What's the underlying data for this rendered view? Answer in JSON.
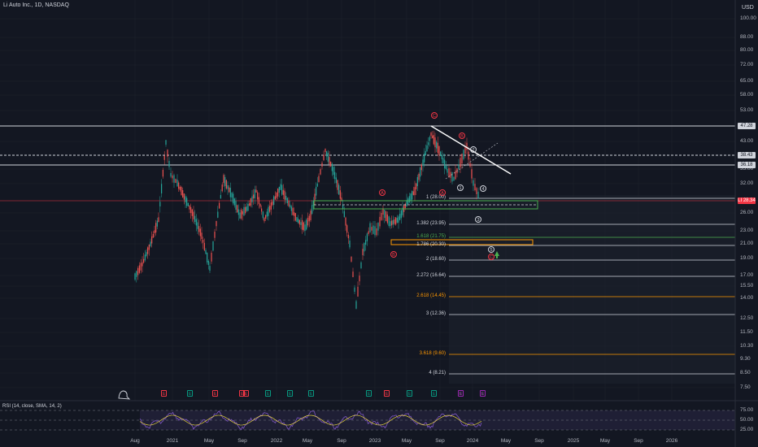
{
  "header": {
    "symbol": "Li Auto Inc., 1D, NASDAQ",
    "currency": "USD"
  },
  "colors": {
    "background": "#131722",
    "up": "#26a69a",
    "down": "#ef5350",
    "rsi": "#7e57c2",
    "accent": "#ff9800"
  },
  "price_axis": {
    "ticks": [
      "100.00",
      "88.00",
      "80.00",
      "72.00",
      "65.00",
      "58.00",
      "53.00",
      "43.00",
      "35.00",
      "32.00",
      "26.00",
      "23.00",
      "21.00",
      "19.00",
      "17.00",
      "15.50",
      "14.00",
      "12.50",
      "11.50",
      "10.30",
      "9.30",
      "8.50",
      "7.50"
    ],
    "levels": [
      {
        "value": "47.28",
        "color": "#d1d4dc"
      },
      {
        "value": "38.43",
        "color": "#d1d4dc"
      },
      {
        "value": "36.18",
        "color": "#d1d4dc"
      },
      {
        "value": "28.34",
        "color": "#f23645",
        "prefix": "LI"
      }
    ]
  },
  "time_axis": {
    "ticks": [
      "Aug",
      "2021",
      "May",
      "Sep",
      "2022",
      "May",
      "Sep",
      "2023",
      "May",
      "Sep",
      "2024",
      "May",
      "Sep",
      "2025",
      "May",
      "Sep",
      "2026"
    ]
  },
  "fib_levels": [
    {
      "label": "1 (28.00)",
      "value": 28.0,
      "color": "#d1d4dc"
    },
    {
      "label": "1.382 (23.95)",
      "value": 23.95,
      "color": "#d1d4dc"
    },
    {
      "label": "1.618 (21.75)",
      "value": 21.75,
      "color": "#4caf50"
    },
    {
      "label": "1.786 (20.30)",
      "value": 20.3,
      "color": "#d1d4dc"
    },
    {
      "label": "2 (18.60)",
      "value": 18.6,
      "color": "#d1d4dc"
    },
    {
      "label": "2.272 (16.64)",
      "value": 16.64,
      "color": "#d1d4dc"
    },
    {
      "label": "2.618 (14.45)",
      "value": 14.45,
      "color": "#ff9800"
    },
    {
      "label": "3 (12.36)",
      "value": 12.36,
      "color": "#d1d4dc"
    },
    {
      "label": "3.618 (9.60)",
      "value": 9.6,
      "color": "#ff9800"
    },
    {
      "label": "4 (8.21)",
      "value": 8.21,
      "color": "#d1d4dc"
    }
  ],
  "waves": [
    {
      "label": "C",
      "color": "red"
    },
    {
      "label": "B",
      "color": "red"
    },
    {
      "label": "A",
      "color": "red"
    },
    {
      "label": "A",
      "color": "red"
    },
    {
      "label": "B",
      "color": "red"
    },
    {
      "label": "C",
      "color": "red"
    },
    {
      "label": "1",
      "color": "white"
    },
    {
      "label": "2",
      "color": "white"
    },
    {
      "label": "3",
      "color": "white"
    },
    {
      "label": "4",
      "color": "white"
    },
    {
      "label": "5",
      "color": "white"
    }
  ],
  "events": [
    {
      "label": "E",
      "type": "e"
    },
    {
      "label": "E",
      "type": "d"
    },
    {
      "label": "E",
      "type": "e"
    },
    {
      "label": "E",
      "type": "e"
    },
    {
      "label": "E",
      "type": "e"
    },
    {
      "label": "E",
      "type": "d"
    },
    {
      "label": "E",
      "type": "d"
    },
    {
      "label": "E",
      "type": "d"
    },
    {
      "label": "E",
      "type": "d"
    },
    {
      "label": "E",
      "type": "e"
    },
    {
      "label": "E",
      "type": "d"
    },
    {
      "label": "E",
      "type": "d"
    },
    {
      "label": "E",
      "type": "p"
    },
    {
      "label": "E",
      "type": "p"
    }
  ],
  "rsi": {
    "label": "RSI (14, close, SMA, 14, 2)",
    "ticks": [
      "75.00",
      "50.00",
      "25.00"
    ]
  }
}
